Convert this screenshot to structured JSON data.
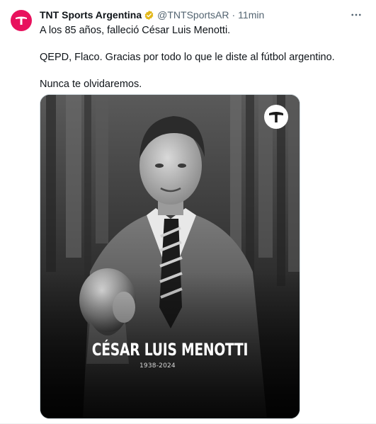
{
  "tweet": {
    "display_name": "TNT Sports Argentina",
    "handle": "@TNTSportsAR",
    "separator": "·",
    "time": "11min",
    "verified_icon": "verified-badge-icon",
    "more_icon": "more-horizontal-icon",
    "lines": [
      "A los 85 años, falleció César Luis Menotti.",
      "QEPD, Flaco. Gracias por todo lo que le diste al fútbol argentino.",
      "Nunca te olvidaremos."
    ]
  },
  "media": {
    "overlay_name": "CÉSAR LUIS MENOTTI",
    "overlay_years": "1938-2024",
    "logo_icon": "tnt-logo-icon"
  },
  "colors": {
    "brand": "#e8115d",
    "verified": "#e2b719",
    "secondary_text": "#536471",
    "primary_text": "#0f1419"
  }
}
